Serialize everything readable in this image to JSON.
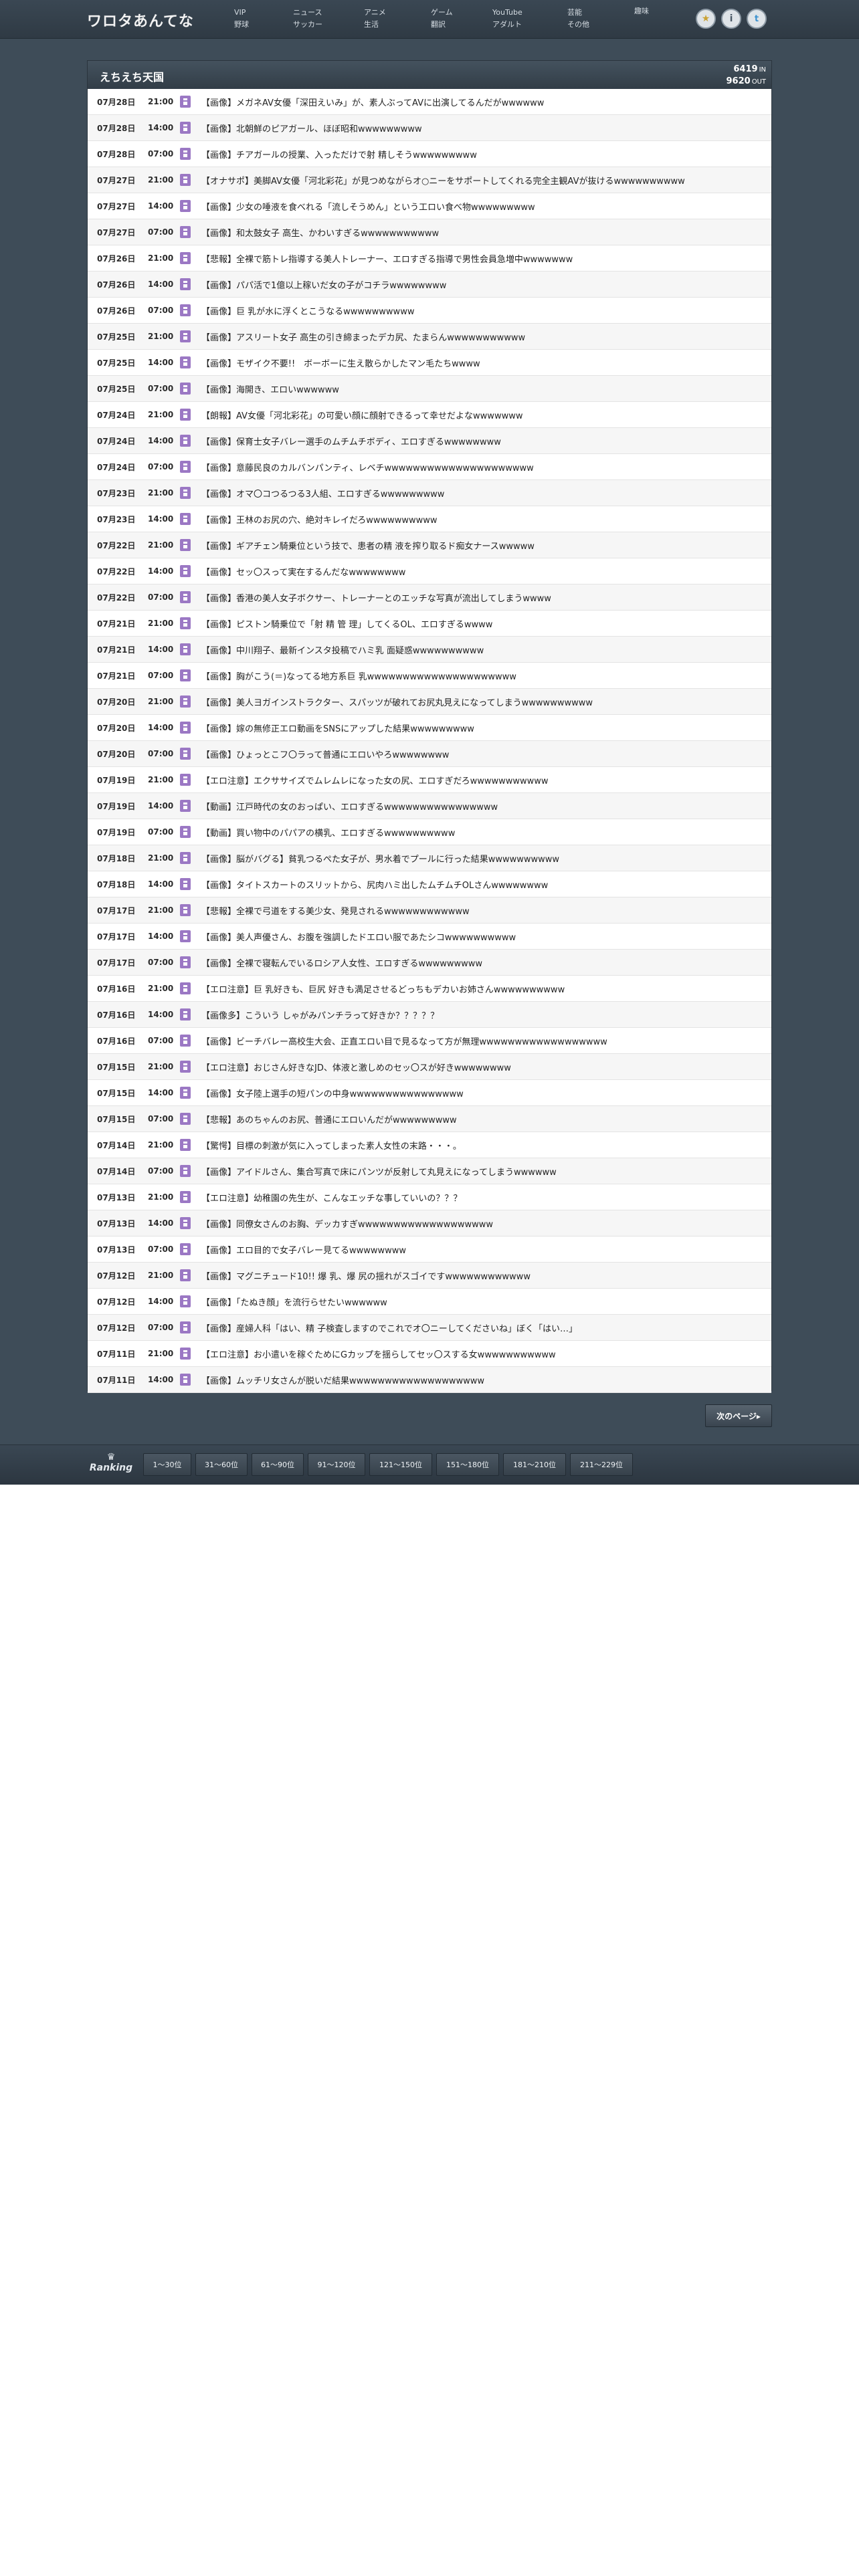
{
  "header": {
    "logo": "ワロタあんてな",
    "nav": [
      {
        "label": "VIP"
      },
      {
        "label": "ニュース"
      },
      {
        "label": "アニメ"
      },
      {
        "label": "ゲーム"
      },
      {
        "label": "YouTube"
      },
      {
        "label": "芸能"
      },
      {
        "label": "趣味"
      },
      {
        "label": "野球"
      },
      {
        "label": "サッカー"
      },
      {
        "label": "生活"
      },
      {
        "label": "翻訳"
      },
      {
        "label": "アダルト"
      },
      {
        "label": "その他"
      }
    ],
    "buttons": {
      "star": "★",
      "info": "i",
      "twitter": "t"
    }
  },
  "panel": {
    "title": "えちえち天国",
    "in_count": "6419",
    "in_label": "IN",
    "out_count": "9620",
    "out_label": "OUT"
  },
  "articles": [
    {
      "date": "07月28日",
      "time": "21:00",
      "title": "【画像】メガネAV女優「深田えいみ」が、素人ぶってAVに出演してるんだがwwwwww"
    },
    {
      "date": "07月28日",
      "time": "14:00",
      "title": "【画像】北朝鮮のピアガール、ほぼ昭和wwwwwwwww"
    },
    {
      "date": "07月28日",
      "time": "07:00",
      "title": "【画像】チアガールの授業、入っただけで射 精しそうwwwwwwwww"
    },
    {
      "date": "07月27日",
      "time": "21:00",
      "title": "【オナサポ】美脚AV女優「河北彩花」が見つめながらオ○ニーをサポートしてくれる完全主観AVが抜けるwwwwwwwwww"
    },
    {
      "date": "07月27日",
      "time": "14:00",
      "title": "【画像】少女の唾液を食べれる「流しそうめん」という工ロい食べ物wwwwwwwww"
    },
    {
      "date": "07月27日",
      "time": "07:00",
      "title": "【画像】和太鼓女子 高生、かわいすぎるwwwwwwwwwww"
    },
    {
      "date": "07月26日",
      "time": "21:00",
      "title": "【悲報】全裸で筋トレ指導する美人トレーナー、エロすぎる指導で男性会員急増中wwwwwww"
    },
    {
      "date": "07月26日",
      "time": "14:00",
      "title": "【画像】パパ活で1億以上稼いだ女の子がコチラwwwwwwww"
    },
    {
      "date": "07月26日",
      "time": "07:00",
      "title": "【画像】巨 乳が水に浮くとこうなるwwwwwwwwww"
    },
    {
      "date": "07月25日",
      "time": "21:00",
      "title": "【画像】アスリート女子 高生の引き締まったデカ尻、たまらんwwwwwwwwwww"
    },
    {
      "date": "07月25日",
      "time": "14:00",
      "title": "【画像】モザイク不要!!　ボーボーに生え散らかしたマン毛たちwwww"
    },
    {
      "date": "07月25日",
      "time": "07:00",
      "title": "【画像】海開き、エロいwwwwww"
    },
    {
      "date": "07月24日",
      "time": "21:00",
      "title": "【朗報】AV女優「河北彩花」の可愛い顔に顔射できるって幸せだよなwwwwwww"
    },
    {
      "date": "07月24日",
      "time": "14:00",
      "title": "【画像】保育士女子バレー選手のムチムチボディ、エロすぎるwwwwwwww"
    },
    {
      "date": "07月24日",
      "time": "07:00",
      "title": "【画像】意藤民良のカルバンパンティ、レベチwwwwwwwwwwwwwwwwwwwww"
    },
    {
      "date": "07月23日",
      "time": "21:00",
      "title": "【画像】オマ〇コつるつる3人組、エロすぎるwwwwwwwww"
    },
    {
      "date": "07月23日",
      "time": "14:00",
      "title": "【画像】王林のお尻の穴、絶対キレイだろwwwwwwwwww"
    },
    {
      "date": "07月22日",
      "time": "21:00",
      "title": "【画像】ギアチェン騎乗位という技で、患者の精 液を搾り取るド痴女ナースwwwww"
    },
    {
      "date": "07月22日",
      "time": "14:00",
      "title": "【画像】セッ〇スって実在するんだなwwwwwwww"
    },
    {
      "date": "07月22日",
      "time": "07:00",
      "title": "【画像】香港の美人女子ボクサー、トレーナーとのエッチな写真が流出してしまうwwww"
    },
    {
      "date": "07月21日",
      "time": "21:00",
      "title": "【画像】ピストン騎乗位で「射 精 管 理」してくるOL、エロすぎるwwww"
    },
    {
      "date": "07月21日",
      "time": "14:00",
      "title": "【画像】中川翔子、最新インスタ投稿でハミ乳 面疑惑wwwwwwwwww"
    },
    {
      "date": "07月21日",
      "time": "07:00",
      "title": "【画像】胸がこう(＝)なってる地方系巨 乳wwwwwwwwwwwwwwwwwwwww"
    },
    {
      "date": "07月20日",
      "time": "21:00",
      "title": "【画像】美人ヨガインストラクター、スパッツが破れてお尻丸見えになってしまうwwwwwwwwww"
    },
    {
      "date": "07月20日",
      "time": "14:00",
      "title": "【画像】嫁の無修正エロ動画をSNSにアップした結果wwwwwwwww"
    },
    {
      "date": "07月20日",
      "time": "07:00",
      "title": "【画像】ひょっとこフ〇ラって普通にエロいやろwwwwwwww"
    },
    {
      "date": "07月19日",
      "time": "21:00",
      "title": "【エロ注意】エクササイズでムレムレになった女の尻、エロすぎだろwwwwwwwwwww"
    },
    {
      "date": "07月19日",
      "time": "14:00",
      "title": "【動画】江戸時代の女のおっぱい、エロすぎるwwwwwwwwwwwwwwww"
    },
    {
      "date": "07月19日",
      "time": "07:00",
      "title": "【動画】買い物中のパパアの横乳、エロすぎるwwwwwwwwww"
    },
    {
      "date": "07月18日",
      "time": "21:00",
      "title": "【画像】脳がバグる】貧乳つるぺた女子が、男水着でプールに行った結果wwwwwwwwww"
    },
    {
      "date": "07月18日",
      "time": "14:00",
      "title": "【画像】タイトスカートのスリットから、尻肉ハミ出したムチムチOLさんwwwwwwww"
    },
    {
      "date": "07月17日",
      "time": "21:00",
      "title": "【悲報】全裸で弓道をする美少女、発見されるwwwwwwwwwwww"
    },
    {
      "date": "07月17日",
      "time": "14:00",
      "title": "【画像】美人声優さん、お腹を強調したドエロい服であたシコwwwwwwwwww"
    },
    {
      "date": "07月17日",
      "time": "07:00",
      "title": "【画像】全裸で寝転んでいるロシア人女性、エロすぎるwwwwwwwww"
    },
    {
      "date": "07月16日",
      "time": "21:00",
      "title": "【エロ注意】巨 乳好きも、巨尻 好きも満足させるどっちもデカいお姉さんwwwwwwwwww"
    },
    {
      "date": "07月16日",
      "time": "14:00",
      "title": "【画像多】こういう しゃがみパンチラって好きか？？？？？"
    },
    {
      "date": "07月16日",
      "time": "07:00",
      "title": "【画像】ビーチバレー高校生大会、正直エロい目で見るなって方が無理wwwwwwwwwwwwwwwwww"
    },
    {
      "date": "07月15日",
      "time": "21:00",
      "title": "【エロ注意】おじさん好きなJD、体液と激しめのセッ〇スが好きwwwwwwww"
    },
    {
      "date": "07月15日",
      "time": "14:00",
      "title": "【画像】女子陸上選手の短パンの中身wwwwwwwwwwwwwwww"
    },
    {
      "date": "07月15日",
      "time": "07:00",
      "title": "【悲報】あのちゃんのお尻、普通にエロいんだがwwwwwwwww"
    },
    {
      "date": "07月14日",
      "time": "21:00",
      "title": "【驚愕】目標の刺激が気に入ってしまった素人女性の末路・・・。"
    },
    {
      "date": "07月14日",
      "time": "07:00",
      "title": "【画像】アイドルさん、集合写真で床にパンツが反射して丸見えになってしまうwwwwww"
    },
    {
      "date": "07月13日",
      "time": "21:00",
      "title": "【エロ注意】幼稚園の先生が、こんなエッチな事していいの？？？"
    },
    {
      "date": "07月13日",
      "time": "14:00",
      "title": "【画像】同僚女さんのお胸、デッカすぎwwwwwwwwwwwwwwwwwww"
    },
    {
      "date": "07月13日",
      "time": "07:00",
      "title": "【画像】エロ目的で女子バレー見てるwwwwwwww"
    },
    {
      "date": "07月12日",
      "time": "21:00",
      "title": "【画像】マグニチュード10!! 爆 乳、爆 尻の揺れがスゴイですwwwwwwwwwwww"
    },
    {
      "date": "07月12日",
      "time": "14:00",
      "title": "【画像】「たぬき顔」を流行らせたいwwwwww"
    },
    {
      "date": "07月12日",
      "time": "07:00",
      "title": "【画像】産婦人科「はい、精 子検査しますのでこれでオ〇ニーしてくださいね」ぼく「はい…」"
    },
    {
      "date": "07月11日",
      "time": "21:00",
      "title": "【エロ注意】お小遣いを稼ぐためにGカップを揺らしてセッ〇スする女wwwwwwwwwww"
    },
    {
      "date": "07月11日",
      "time": "14:00",
      "title": "【画像】ムッチリ女さんが脱いだ結果wwwwwwwwwwwwwwwwwww"
    }
  ],
  "pagination": {
    "next_label": "次のページ▸"
  },
  "ranking": {
    "label": "Ranking",
    "crown": "♛",
    "tabs": [
      "1〜30位",
      "31〜60位",
      "61〜90位",
      "91〜120位",
      "121〜150位",
      "151〜180位",
      "181〜210位",
      "211〜229位"
    ]
  }
}
